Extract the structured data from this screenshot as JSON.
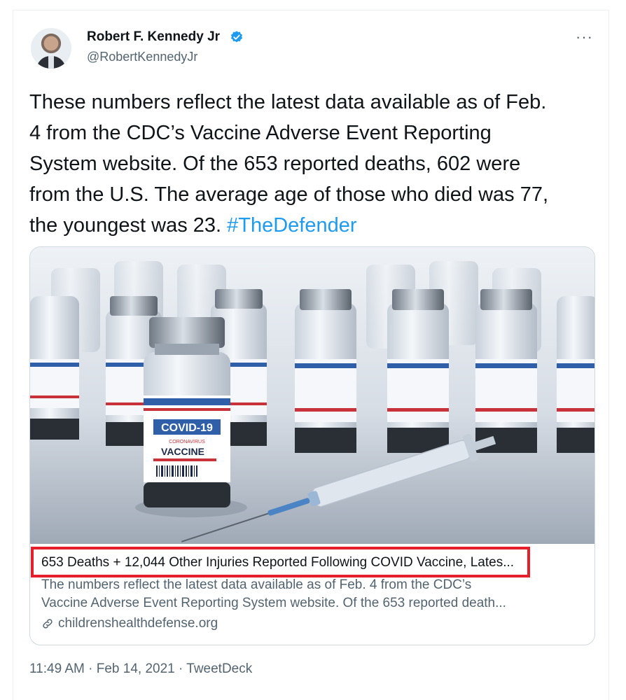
{
  "author": {
    "name": "Robert F. Kennedy Jr",
    "handle": "@RobertKennedyJr",
    "verified": true
  },
  "more_label": "···",
  "tweet": {
    "text_line1": "These numbers reflect the latest data available as of Feb.",
    "text_line2": "4 from the CDC’s Vaccine Adverse Event Reporting",
    "text_line3": "System website. Of the 653 reported deaths, 602 were",
    "text_line4": "from the U.S. The average age of those who died was 77,",
    "text_line5": "the youngest was 23.",
    "hashtag": "#TheDefender"
  },
  "link_card": {
    "image_texts": {
      "label_top": "COVID-19",
      "label_sub": "CORONAVIRUS",
      "label_bottom": "VACCINE"
    },
    "title": "653 Deaths + 12,044 Other Injuries Reported Following COVID Vaccine, Lates...",
    "description_line1": "The numbers reflect the latest data available as of Feb. 4 from the CDC’s",
    "description_line2": "Vaccine Adverse Event Reporting System website. Of the 653 reported death...",
    "domain": "childrenshealthdefense.org",
    "link_icon": "link-icon"
  },
  "timestamp": "11:49 AM · Feb 14, 2021 · TweetDeck",
  "colors": {
    "hashtag": "#1d9bf0",
    "verified": "#1d9bf0",
    "highlight": "#e5202a",
    "secondary_text": "#536471"
  }
}
